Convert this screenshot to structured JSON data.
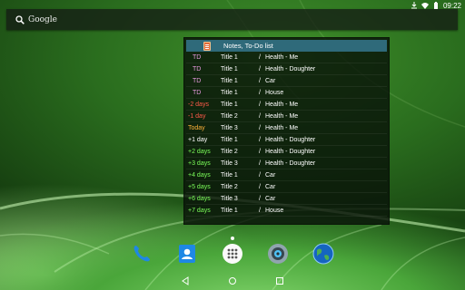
{
  "status_bar": {
    "time": "09:22",
    "icons": [
      "download-icon",
      "wifi-icon",
      "battery-icon"
    ]
  },
  "search": {
    "label": "Google",
    "icon": "search-icon"
  },
  "widget": {
    "header": "Notes, To-Do list",
    "header_color": "#2f6a7a",
    "rows": [
      {
        "when": "TD",
        "title": "Title 1",
        "sep": "/",
        "category": "Health - Me",
        "color": "#e89be0"
      },
      {
        "when": "TD",
        "title": "Title 1",
        "sep": "/",
        "category": "Health - Doughter",
        "color": "#e89be0"
      },
      {
        "when": "TD",
        "title": "Title 1",
        "sep": "/",
        "category": "Car",
        "color": "#e89be0"
      },
      {
        "when": "TD",
        "title": "Title 1",
        "sep": "/",
        "category": "House",
        "color": "#e89be0"
      },
      {
        "when": "-2 days",
        "title": "Title 1",
        "sep": "/",
        "category": "Health - Me",
        "color": "#ff5a4a"
      },
      {
        "when": "-1 day",
        "title": "Title 2",
        "sep": "/",
        "category": "Health - Me",
        "color": "#ff5a4a"
      },
      {
        "when": "Today",
        "title": "Title 3",
        "sep": "/",
        "category": "Health - Me",
        "color": "#ffb23a"
      },
      {
        "when": "+1 day",
        "title": "Title 1",
        "sep": "/",
        "category": "Health - Doughter",
        "color": "#ffffff"
      },
      {
        "when": "+2 days",
        "title": "Title 2",
        "sep": "/",
        "category": "Health - Doughter",
        "color": "#7cff5a"
      },
      {
        "when": "+3 days",
        "title": "Title 3",
        "sep": "/",
        "category": "Health - Doughter",
        "color": "#7cff5a"
      },
      {
        "when": "+4 days",
        "title": "Title 1",
        "sep": "/",
        "category": "Car",
        "color": "#7cff5a"
      },
      {
        "when": "+5 days",
        "title": "Title 2",
        "sep": "/",
        "category": "Car",
        "color": "#7cff5a"
      },
      {
        "when": "+6 days",
        "title": "Title 3",
        "sep": "/",
        "category": "Car",
        "color": "#7cff5a"
      },
      {
        "when": "+7 days",
        "title": "Title 1",
        "sep": "/",
        "category": "House",
        "color": "#7cff5a"
      }
    ]
  },
  "dock": {
    "apps": [
      {
        "name": "phone-icon"
      },
      {
        "name": "contacts-icon"
      },
      {
        "name": "app-drawer-icon"
      },
      {
        "name": "camera-icon"
      },
      {
        "name": "browser-globe-icon"
      }
    ]
  },
  "nav": {
    "buttons": [
      "back-icon",
      "home-icon",
      "recents-icon"
    ]
  }
}
